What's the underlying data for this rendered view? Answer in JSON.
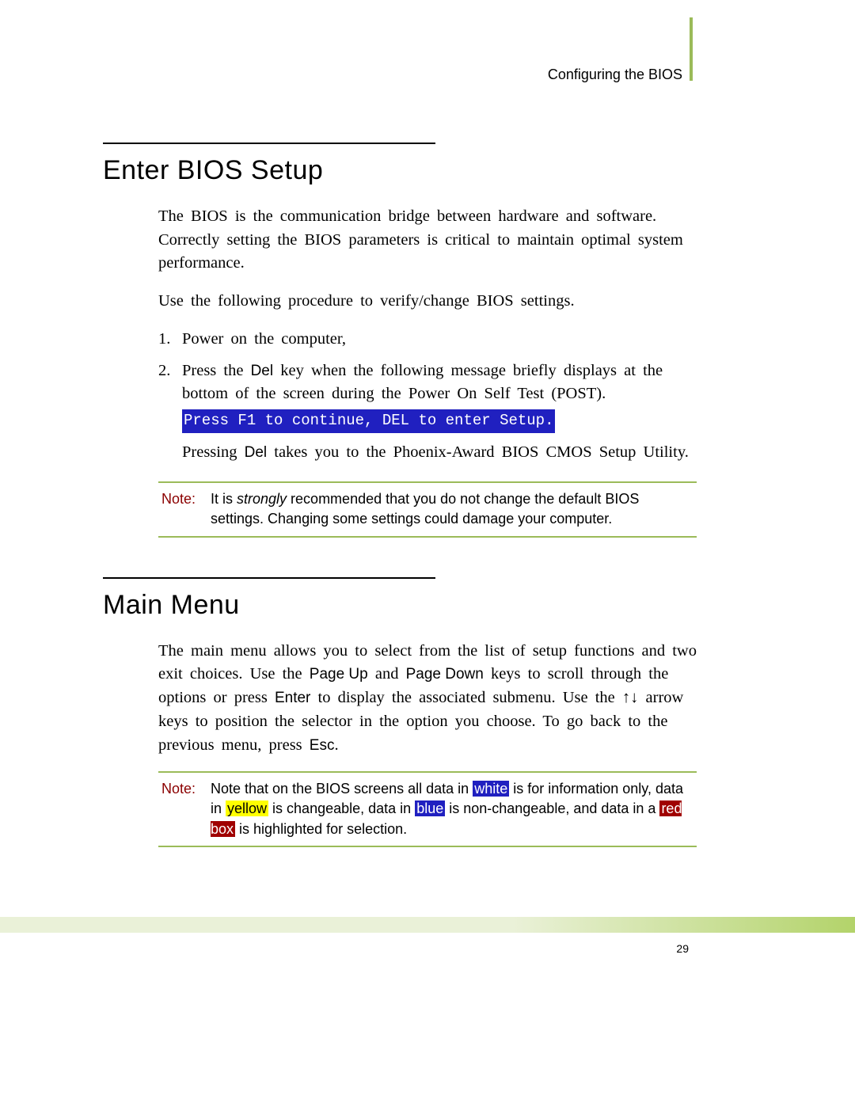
{
  "header": {
    "text": "Configuring the BIOS"
  },
  "section1": {
    "heading": "Enter BIOS Setup",
    "para1": "The BIOS is the communication bridge between hardware and software. Correctly setting the BIOS parameters is critical to maintain optimal system performance.",
    "para2": "Use the following procedure to verify/change BIOS settings.",
    "step1_num": "1.",
    "step1": "Power on the computer,",
    "step2_num": "2.",
    "step2_a": "Press the ",
    "step2_key": "Del",
    "step2_b": " key when the following message briefly displays at the bottom of the screen during the Power On Self Test (POST).",
    "step2_code": "Press F1 to continue, DEL to enter Setup.",
    "step2_c1": "Pressing ",
    "step2_c_key": "Del",
    "step2_c2": " takes you to the Phoenix-Award BIOS CMOS Setup Utility.",
    "note_label": "Note:",
    "note_a": "It is ",
    "note_em": "strongly",
    "note_b": " recommended that you do not change the default BIOS settings. Changing some settings could damage your computer."
  },
  "section2": {
    "heading": "Main Menu",
    "para_a": "The main menu allows you to select from the list of setup functions and two exit choices. Use the ",
    "key_pu": "Page Up",
    "para_b": " and ",
    "key_pd": "Page Down",
    "para_c": " keys to scroll through the options or press ",
    "key_enter": "Enter",
    "para_d": " to display the associated submenu. Use the ↑↓ arrow keys to position the selector in the option you choose. To go back to the previous menu, press ",
    "key_esc": "Esc",
    "para_e": ".",
    "note_label": "Note:",
    "n_a": "Note that on the BIOS screens all data in ",
    "n_white": "white",
    "n_b": " is for information only, data in ",
    "n_yellow": "yellow",
    "n_c": " is changeable, data in ",
    "n_blue": "blue",
    "n_d": " is non-changeable, and data in a ",
    "n_red": "red box",
    "n_e": " is highlighted for selection."
  },
  "page_number": "29"
}
